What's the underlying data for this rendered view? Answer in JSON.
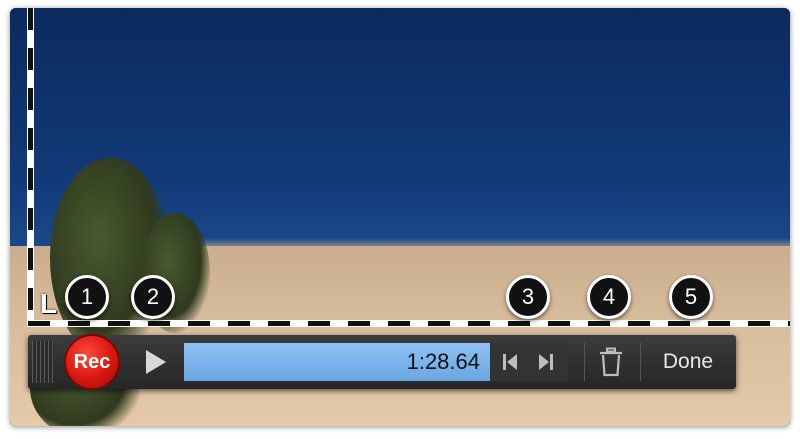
{
  "scene": {
    "corner_label": "L"
  },
  "callouts": [
    "1",
    "2",
    "3",
    "4",
    "5"
  ],
  "toolbar": {
    "rec_label": "Rec",
    "time": "1:28.64",
    "done_label": "Done",
    "icons": {
      "grip": "grip-handle-icon",
      "play": "play-icon",
      "skip_back": "skip-to-start-icon",
      "skip_forward": "skip-to-end-icon",
      "trash": "trash-icon"
    }
  },
  "colors": {
    "rec": "#d7160f",
    "progress": "#6aa6e3",
    "toolbar": "#2e2e2e",
    "badge": "#111111"
  }
}
